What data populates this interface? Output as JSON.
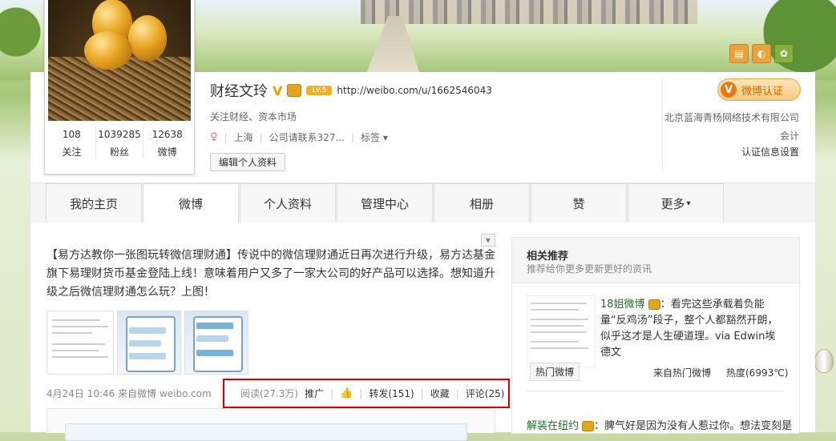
{
  "profile": {
    "name": "财经文玲",
    "v_badge": "V",
    "level_badge": "LV.5",
    "url": "http://weibo.com/u/1662546043",
    "description": "关注财经、资本市场",
    "location": "上海",
    "company": "公司请联系327...",
    "tags_label": "标签",
    "edit_label": "编辑个人资料",
    "stats": [
      {
        "num": "108",
        "label": "关注"
      },
      {
        "num": "1039285",
        "label": "粉丝"
      },
      {
        "num": "12638",
        "label": "微博"
      }
    ]
  },
  "verify": {
    "button_label": "微博认证",
    "company": "北京蓝海青杨网络技术有限公司会计",
    "settings_label": "认证信息设置"
  },
  "tabs": [
    "我的主页",
    "微博",
    "个人资料",
    "管理中心",
    "相册",
    "赞",
    "更多"
  ],
  "post": {
    "text": "【易方达教你一张图玩转微信理财通】传说中的微信理财通近日再次进行升级，易方达基金旗下易理财货币基金登陆上线！意味着用户又多了一家大公司的好产品可以选择。想知道升级之后微信理财通怎么玩？上图！",
    "date": "4月24日 10:46",
    "source": "来自微博 weibo.com",
    "read": "阅读(27.3万)",
    "promote": "推广",
    "repost": "转发(151)",
    "favorite": "收藏",
    "comment": "评论(25)"
  },
  "sidebar": {
    "title": "相关推荐",
    "subtitle": "推荐给你更多更新更好的资讯",
    "author": "18姐微博",
    "text": "：看完这些承载着负能量“反鸡汤”段子，整个人都豁然开朗，似乎这才是人生硬道理。via Edwin埃德文",
    "hot_tag": "热门微博",
    "from": "来自热门微博",
    "hot_value": "热度(6993℃)",
    "next_author": "解装在纽约",
    "next_text": "：脾气好是因为没有人惹过你。想法变刻是"
  }
}
